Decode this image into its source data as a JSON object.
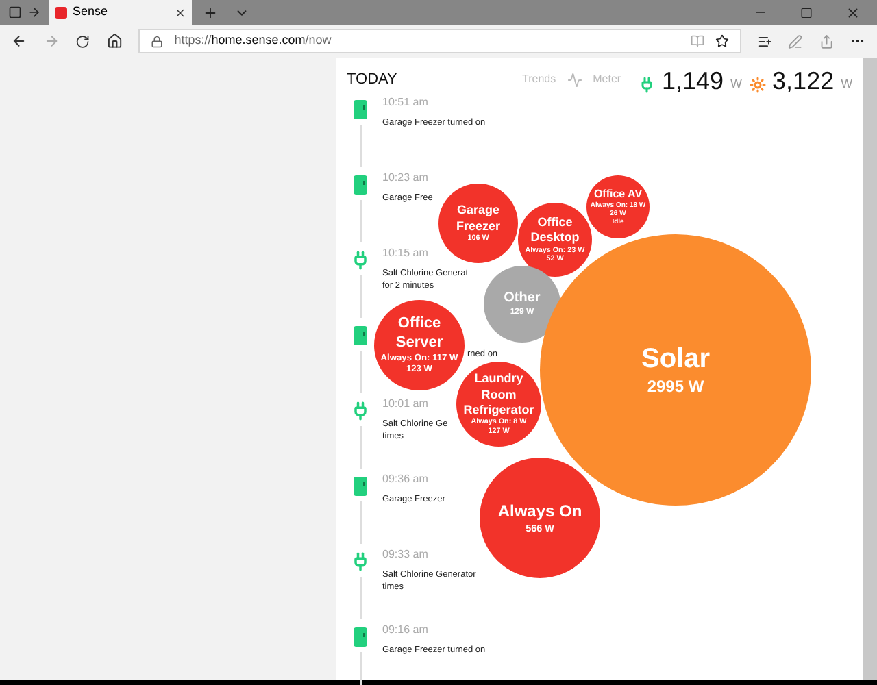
{
  "browser": {
    "tab_title": "Sense",
    "url_prefix": "https://",
    "url_host": "home.sense.com",
    "url_path": "/now"
  },
  "header": {
    "title": "TODAY",
    "nav": [
      "Trends",
      "Meter"
    ],
    "usage": {
      "value": "1,149",
      "unit": "W"
    },
    "solar": {
      "value": "3,122",
      "unit": "W"
    }
  },
  "timeline": [
    {
      "kind": "freezer",
      "time": "10:51 am",
      "text": "Garage Freezer turned on"
    },
    {
      "kind": "freezer",
      "time": "10:23 am",
      "text": "Garage Free"
    },
    {
      "kind": "plug",
      "time": "10:15 am",
      "text": "Salt Chlorine Generat",
      "text2": "for 2 minutes"
    },
    {
      "kind": "freezer",
      "text": "rned on"
    },
    {
      "kind": "plug",
      "time": "10:01 am",
      "text": "Salt Chlorine Ge",
      "text2": "times"
    },
    {
      "kind": "freezer",
      "time": "09:36 am",
      "text": "Garage Freezer"
    },
    {
      "kind": "plug",
      "time": "09:33 am",
      "text": "Salt Chlorine Generator",
      "text2": "times"
    },
    {
      "kind": "freezer",
      "time": "09:16 am",
      "text": "Garage Freezer turned on"
    }
  ],
  "bubbles": [
    {
      "name": "Garage Freezer",
      "lines": [
        "106 W"
      ],
      "color": "#f2332a"
    },
    {
      "name": "Office Desktop",
      "lines": [
        "Always On: 23 W",
        "52 W"
      ],
      "color": "#f2332a"
    },
    {
      "name": "Office AV",
      "lines": [
        "Always On: 18 W",
        "26 W",
        "Idle"
      ],
      "color": "#f2332a"
    },
    {
      "name": "Other",
      "lines": [
        "129 W"
      ],
      "color": "#a9a9a9"
    },
    {
      "name": "Office Server",
      "lines": [
        "Always On: 117 W",
        "123 W"
      ],
      "color": "#f2332a"
    },
    {
      "name": "Laundry Room Refrigerator",
      "lines": [
        "Always On: 8 W",
        "127 W"
      ],
      "color": "#f2332a"
    },
    {
      "name": "Solar",
      "lines": [
        "2995 W"
      ],
      "color": "#fb8c2e"
    },
    {
      "name": "Always On",
      "lines": [
        "566 W"
      ],
      "color": "#f2332a"
    }
  ]
}
